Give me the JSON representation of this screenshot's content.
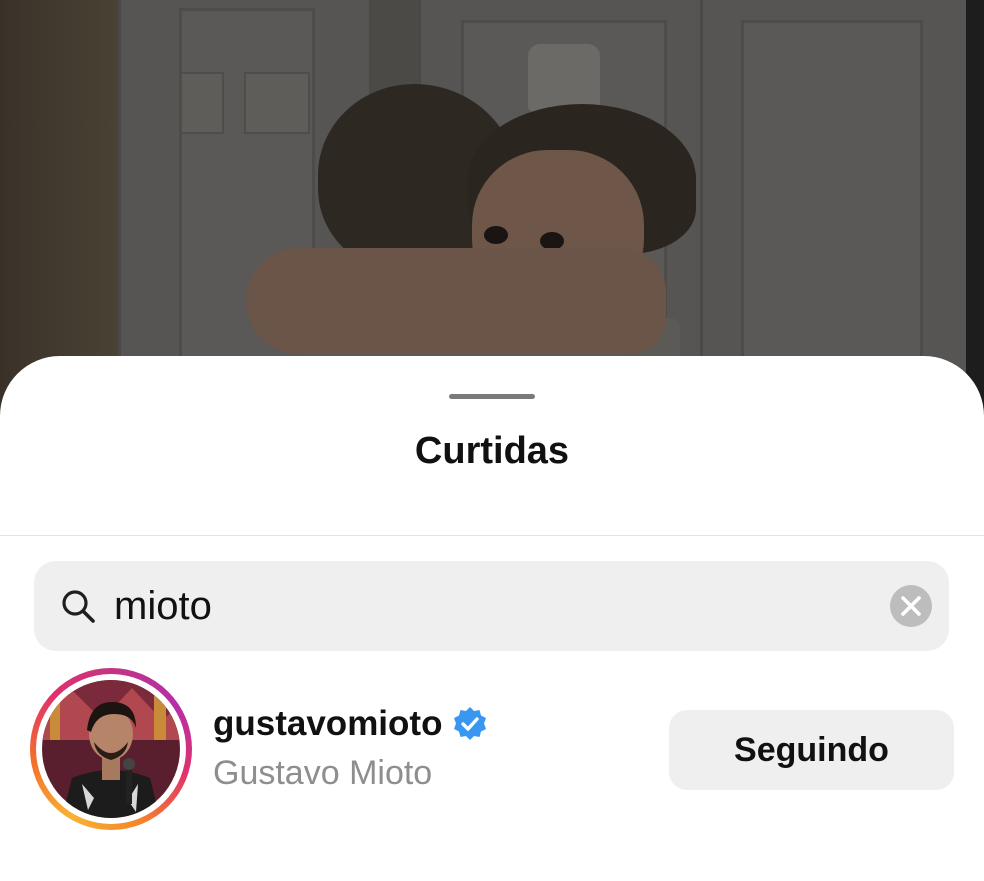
{
  "sheet": {
    "title": "Curtidas"
  },
  "search": {
    "value": "mioto",
    "icon": "search-icon",
    "clear_icon": "clear-icon"
  },
  "results": [
    {
      "username": "gustavomioto",
      "full_name": "Gustavo Mioto",
      "verified": true,
      "follow_label": "Seguindo"
    }
  ],
  "colors": {
    "verified_blue": "#3897f0",
    "sheet_background": "#ffffff",
    "field_background": "#efefef",
    "secondary_text": "#8e8e8e"
  }
}
